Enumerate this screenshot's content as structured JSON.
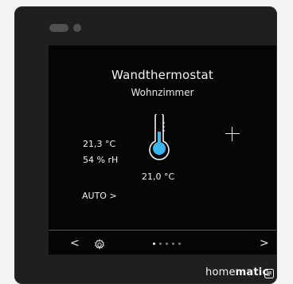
{
  "device": {
    "title": "Wandthermostat",
    "room": "Wohnzimmer",
    "temperature_current": "21,3 °C",
    "humidity": "54 % rH",
    "mode": "AUTO",
    "mode_arrow": ">",
    "temperature_setpoint": "21,0 °C"
  },
  "navigation": {
    "left": "<",
    "right": ">",
    "active_page": 1,
    "page_count": 5
  },
  "brand": {
    "prefix": "home",
    "name": "matic"
  },
  "icons": {
    "thermometer": "thermometer-icon",
    "settings": "gear-icon",
    "increase": "plus-icon",
    "brand_mark": "brand-badge-icon"
  },
  "colors": {
    "thermometer_fill": "#38b8f0",
    "screen_bg": "#050505",
    "device_bg": "#1f1f1f"
  }
}
